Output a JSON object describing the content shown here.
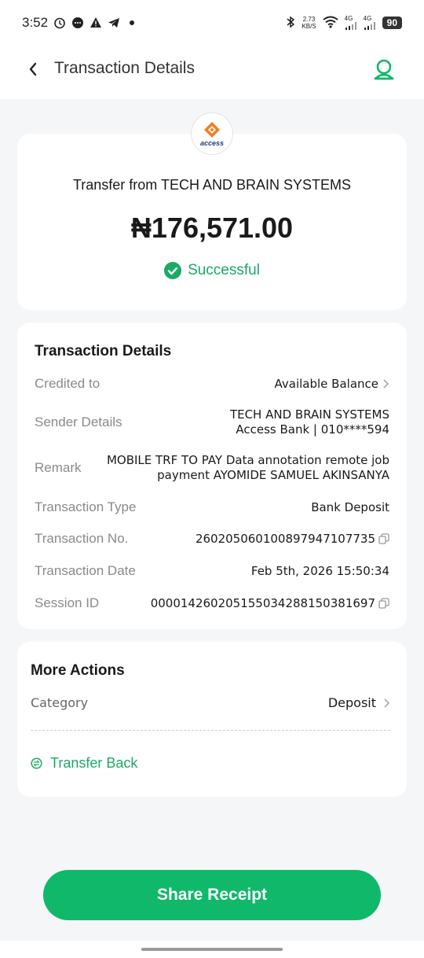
{
  "status_bar": {
    "time": "3:52",
    "speed_value": "2.73",
    "speed_unit": "KB/S",
    "net1": "4G",
    "net2": "4G",
    "battery": "90"
  },
  "header": {
    "title": "Transaction Details"
  },
  "summary": {
    "bank_logo_text": "access",
    "transfer_title": "Transfer from TECH AND BRAIN SYSTEMS",
    "amount": "₦176,571.00",
    "status": "Successful"
  },
  "details": {
    "title": "Transaction Details",
    "credited_to_label": "Credited to",
    "credited_to_value": "Available Balance",
    "sender_label": "Sender Details",
    "sender_line1": "TECH AND BRAIN SYSTEMS",
    "sender_line2": "Access Bank | 010****594",
    "remark_label": "Remark",
    "remark_line1": "MOBILE TRF TO PAY Data annotation remote job",
    "remark_line2": "payment AYOMIDE SAMUEL AKINSANYA",
    "type_label": "Transaction Type",
    "type_value": "Bank Deposit",
    "number_label": "Transaction No.",
    "number_value": "260205060100897947107735",
    "date_label": "Transaction Date",
    "date_value": "Feb 5th, 2026 15:50:34",
    "session_label": "Session ID",
    "session_value": "000014260205155034288150381697"
  },
  "actions": {
    "title": "More Actions",
    "category_label": "Category",
    "category_value": "Deposit",
    "transfer_back": "Transfer Back"
  },
  "share_button": "Share Receipt",
  "colors": {
    "accent": "#10b86a",
    "status_green": "#1aaa66",
    "background": "#f5f6f8"
  }
}
